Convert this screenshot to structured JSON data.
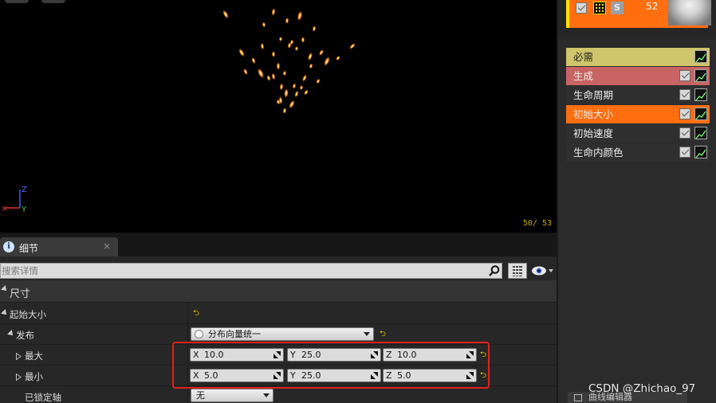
{
  "viewport": {
    "counter": "50/  53",
    "axis": {
      "z": "Z",
      "y": "Y"
    },
    "colors": {
      "spark_core": "#ffe9a0",
      "spark_glow": "#ff7a10"
    }
  },
  "emitter": {
    "particle_count": "52",
    "solo_label": "S",
    "colors": {
      "header": "#ff6e0f",
      "accent": "#ffe100"
    }
  },
  "modules": [
    {
      "label": "必需",
      "state": "required"
    },
    {
      "label": "生成",
      "state": "spawn"
    },
    {
      "label": "生命周期",
      "state": "normal"
    },
    {
      "label": "初始大小",
      "state": "selected"
    },
    {
      "label": "初始速度",
      "state": "normal"
    },
    {
      "label": "生命内颜色",
      "state": "normal"
    }
  ],
  "curve_editor_tab": "曲线编辑器",
  "details": {
    "tab_title": "细节",
    "close_glyph": "×",
    "search_placeholder": "搜索详情",
    "category": "尺寸",
    "start_size_label": "起始大小",
    "distribution_label": "发布",
    "distribution_value": "分布向量统一",
    "max_label": "最大",
    "min_label": "最小",
    "locked_axes_label": "已锁定轴",
    "locked_axes_value": "无",
    "max": {
      "x": "10.0",
      "y": "25.0",
      "z": "10.0"
    },
    "min": {
      "x": "5.0",
      "y": "25.0",
      "z": "5.0"
    },
    "axis_labels": {
      "x": "X",
      "y": "Y",
      "z": "Z"
    }
  },
  "watermark": "CSDN @Zhichao_97",
  "colors": {
    "highlight_box": "#e02020",
    "reset_arrow": "#ffd400"
  }
}
